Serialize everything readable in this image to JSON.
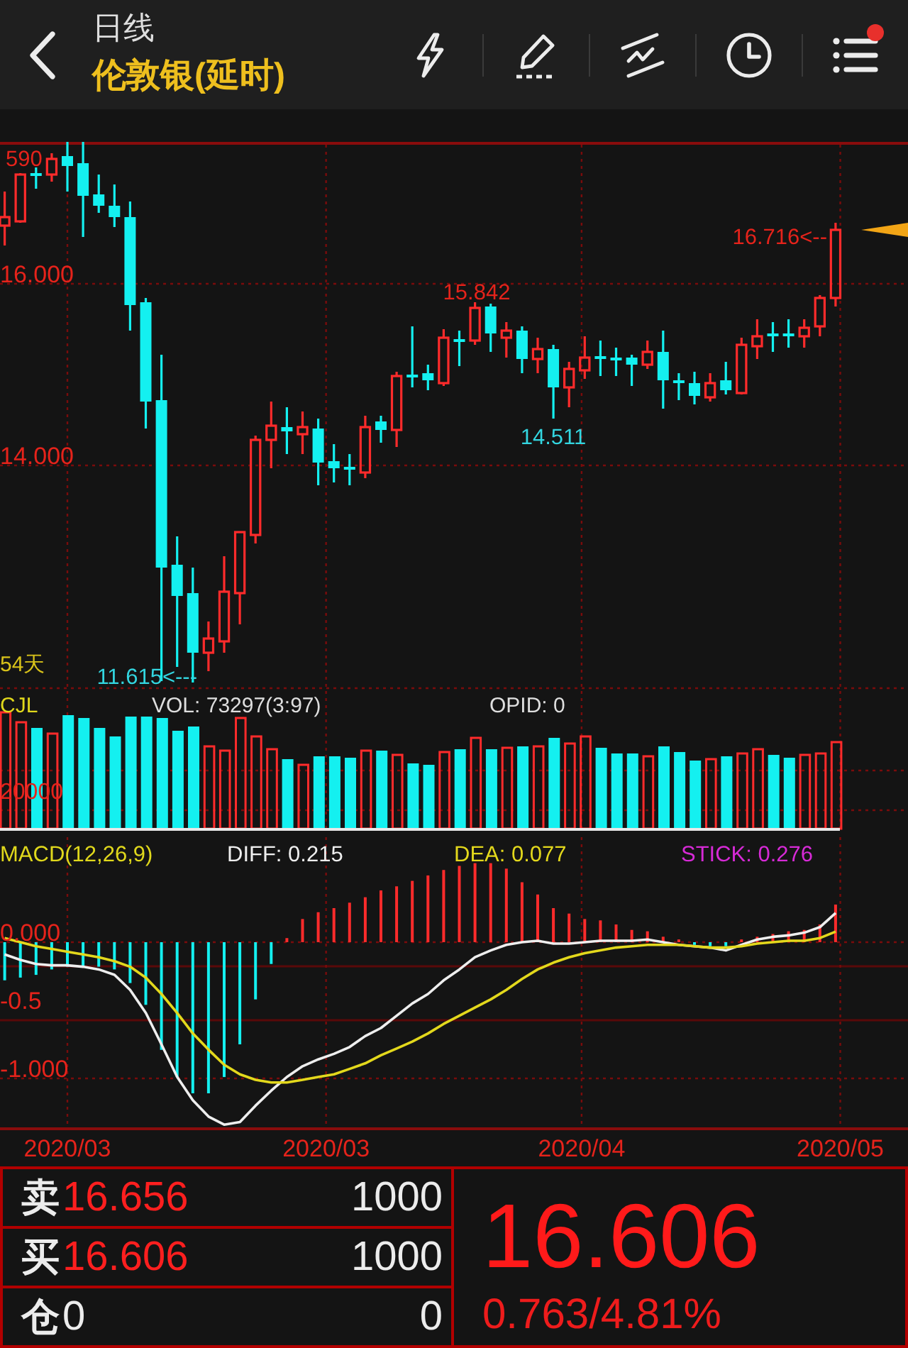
{
  "header": {
    "title": "日线",
    "subtitle": "伦敦银(延时)",
    "menu_badge": true
  },
  "price_chart": {
    "axis_labels": [
      "16.000",
      "14.000"
    ],
    "markers": [
      {
        "text": "590",
        "kind": "high"
      },
      {
        "text": "15.842",
        "kind": "high"
      },
      {
        "text": "16.716<--",
        "kind": "high"
      },
      {
        "text": "14.511",
        "kind": "low"
      },
      {
        "text": "11.615<---",
        "kind": "low"
      }
    ],
    "period_label": "54天"
  },
  "volume_panel": {
    "title": "CJL",
    "readings": [
      "VOL: 73297(3:97)",
      "OPID: 0"
    ],
    "axis_label": "20000"
  },
  "macd_panel": {
    "title": "MACD(12,26,9)",
    "readings": [
      {
        "text": "DIFF: 0.215",
        "color": "#eeeeee"
      },
      {
        "text": "DEA: 0.077",
        "color": "#e3d81c"
      },
      {
        "text": "STICK: 0.276",
        "color": "#d62ad6"
      }
    ],
    "axis_labels": [
      "0.000",
      "-0.5",
      "-1.000"
    ]
  },
  "date_labels": [
    "2020/03",
    "2020/03",
    "2020/04",
    "2020/05"
  ],
  "quote": {
    "rows": [
      {
        "label": "卖",
        "price": "16.656",
        "quantity": "1000",
        "kind": "quote"
      },
      {
        "label": "买",
        "price": "16.606",
        "quantity": "1000",
        "kind": "quote"
      },
      {
        "label": "仓",
        "price": "0",
        "quantity": "0",
        "kind": "position"
      }
    ],
    "last_price": "16.606",
    "change": "0.763/4.81%"
  }
}
